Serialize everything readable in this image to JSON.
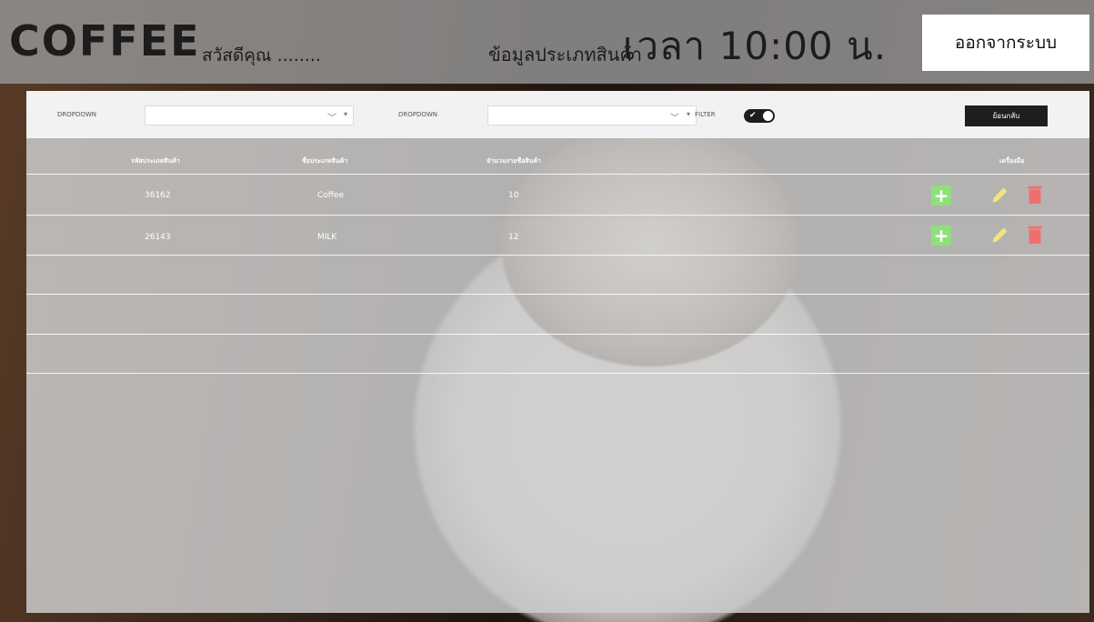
{
  "header": {
    "logo": "COFFEE",
    "greeting": "สวัสดีคุณ ........",
    "page_label": "ข้อมูลประเภทสินค้า",
    "time_label": "เวลา 10:00 น.",
    "logout_label": "ออกจากระบบ"
  },
  "filters": {
    "dropdown1_label": "DROPDOWN",
    "dropdown2_label": "DROPDOWN",
    "filter_label": "FILTER",
    "filter_on": true,
    "back_label": "ย้อนกลับ"
  },
  "table": {
    "columns": [
      "รหัสประเภทสินค้า",
      "ชื่อประเภทสินค้า",
      "จำนวนรายชื่อสินค้า",
      "เครื่องมือ"
    ],
    "rows": [
      {
        "code": "36162",
        "name": "Coffee",
        "count": "10"
      },
      {
        "code": "26143",
        "name": "MILK",
        "count": "12"
      }
    ]
  },
  "colors": {
    "add": "#8ee07d",
    "edit": "#f3e77a",
    "delete": "#ef6f6f"
  }
}
